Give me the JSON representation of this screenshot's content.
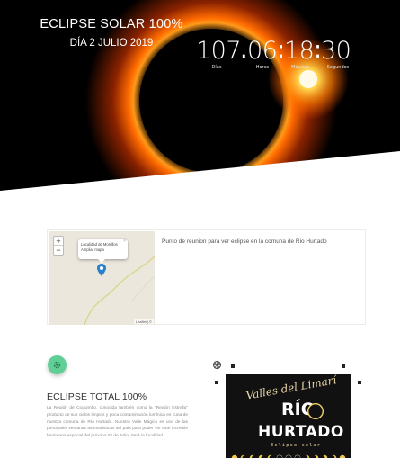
{
  "hero": {
    "title": "ECLIPSE SOLAR 100%",
    "date": "DÍA 2 JULIO 2019",
    "countdown": {
      "days": "107",
      "hours": "06",
      "minutes": "18",
      "seconds": "30",
      "days_label": "Días",
      "hours_label": "Horas",
      "minutes_label": "Minutos",
      "seconds_label": "Segundos"
    }
  },
  "map_section": {
    "popup_text": "Localidad de Morrillos\nAmpliar mapa",
    "popup_close": "×",
    "zoom_in": "+",
    "zoom_out": "−",
    "attribution": "Leaflet | ©",
    "caption": "Punto de reunion para ver eclipse en la comuna de Rio Hurtado"
  },
  "info_section": {
    "title": "ECLIPSE TOTAL 100%",
    "paragraph": "La Región de Coquimbo, conocida también como la \"Región Estrella\" producto de sus cielos limpios y poca contaminación lumínica es cuna de nuestra comuna de Río Hurtado. Nuestro Valle Mágico es una de las principales ventanas astroturísticas del país para poder ver este increíble fenómeno espacial del próximo 02 de Julio. Será la localidad"
  },
  "poster": {
    "script": "Valles del Limarí",
    "rio": "RÍO",
    "hurtado": "HURTADO",
    "eclipse": "Eclipse solar"
  },
  "colors": {
    "accent_green": "#5fcf95",
    "marker_blue": "#2a81cb"
  }
}
